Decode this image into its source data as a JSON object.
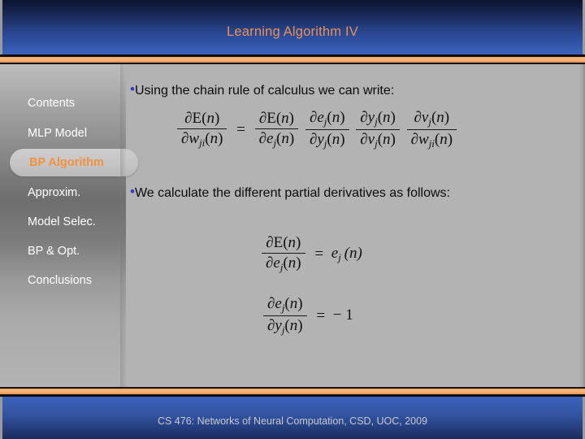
{
  "slide": {
    "title": "Learning Algorithm IV",
    "footer": "CS 476: Networks of Neural Computation, CSD, UOC, 2009",
    "title_color": "#e79254",
    "accent_rule_color": "#f3ad72",
    "body_background": "#b3b3b3",
    "header_background": "#2a4894",
    "active_nav_color": "#f0923e",
    "bullet_color": "#3a38c4"
  },
  "sidebar": {
    "items": [
      {
        "label": "Contents",
        "active": false
      },
      {
        "label": "MLP Model",
        "active": false
      },
      {
        "label": "BP Algorithm",
        "active": true
      },
      {
        "label": "Approxim.",
        "active": false
      },
      {
        "label": "Model Selec.",
        "active": false
      },
      {
        "label": "BP & Opt.",
        "active": false
      },
      {
        "label": "Conclusions",
        "active": false
      }
    ]
  },
  "content": {
    "bullet_glyph": "•",
    "bullets": [
      {
        "text": "Using the chain rule of calculus we can write:"
      },
      {
        "text": "We calculate the different partial derivatives as follows:"
      }
    ],
    "equations": [
      {
        "id": "chain-rule",
        "plain": "∂E(n)/∂w_ji(n) = ∂E(n)/∂e_j(n) · ∂e_j(n)/∂y_j(n) · ∂y_j(n)/∂v_j(n) · ∂v_j(n)/∂w_ji(n)",
        "lhs": {
          "num": "∂E(n)",
          "den": "∂w",
          "den_sub": "ji",
          "den_tail": "(n)"
        },
        "operator": "=",
        "factors": [
          {
            "num": "∂E(n)",
            "den_sym": "∂e",
            "den_sub": "j",
            "den_tail": "(n)",
            "num_sym": "",
            "num_sub": "",
            "num_tail": ""
          },
          {
            "num_sym": "∂e",
            "num_sub": "j",
            "num_tail": "(n)",
            "den_sym": "∂y",
            "den_sub": "j",
            "den_tail": "(n)"
          },
          {
            "num_sym": "∂y",
            "num_sub": "j",
            "num_tail": "(n)",
            "den_sym": "∂v",
            "den_sub": "j",
            "den_tail": "(n)"
          },
          {
            "num_sym": "∂v",
            "num_sub": "j",
            "num_tail": "(n)",
            "den_sym": "∂w",
            "den_sub": "ji",
            "den_tail": "(n)"
          }
        ]
      },
      {
        "id": "dE-de",
        "plain": "∂E(n)/∂e_j(n) = e_j(n)",
        "num": "∂E(n)",
        "den_sym": "∂e",
        "den_sub": "j",
        "den_tail": "(n)",
        "operator": "=",
        "rhs_sym": "e",
        "rhs_sub": "j",
        "rhs_tail": "(n)"
      },
      {
        "id": "de-dy",
        "plain": "∂e_j(n)/∂y_j(n) = −1",
        "num_sym": "∂e",
        "num_sub": "j",
        "num_tail": "(n)",
        "den_sym": "∂y",
        "den_sub": "j",
        "den_tail": "(n)",
        "operator": "=",
        "rhs": "− 1"
      }
    ]
  }
}
